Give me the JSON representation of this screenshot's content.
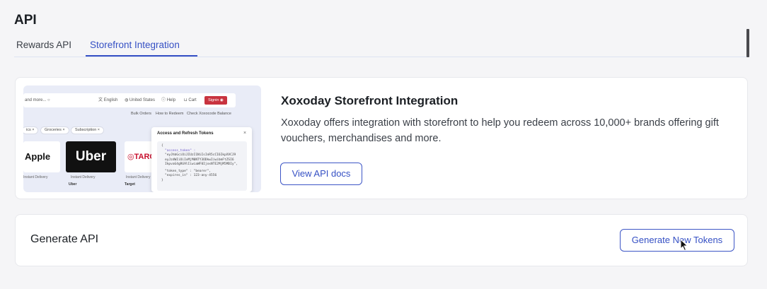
{
  "page": {
    "title": "API"
  },
  "tabs": [
    {
      "label": "Rewards API",
      "active": false
    },
    {
      "label": "Storefront Integration",
      "active": true
    }
  ],
  "integration": {
    "title": "Xoxoday Storefront Integration",
    "description": "Xoxoday offers integration with storefront to help you redeem across 10,000+ brands offering gift vouchers, merchandises and more.",
    "docs_button": "View API docs",
    "preview": {
      "search_text": "and more...",
      "nav": [
        "English",
        "United States",
        "Help",
        "Cart"
      ],
      "signin": "Signin",
      "subnav": [
        "Bulk Orders",
        "How to Redeem",
        "Check Xoxocode Balance"
      ],
      "chips": [
        "ics",
        "Groceries",
        "Subscription"
      ],
      "brands": [
        "Apple",
        "Uber",
        "TARG"
      ],
      "brand_captions": [
        "Instant Delivery",
        "Instant Delivery",
        "Instant Delivery"
      ],
      "brand_names": [
        "Uber",
        "Target"
      ],
      "popup_title": "Access and Refresh Tokens",
      "popup_close": "×",
      "code": {
        "open": "{",
        "access_key": "\"access_token\" :",
        "access_lines": [
          "\"eyJhbGciOiJIUzI1NiIsInR5cCI6IkpXVCJ9",
          "eyJzdWIiOiIxMjM0NTY3ODkwIiwibmFtZSI6",
          "IkpvaG4gRG9lIiwiaWF0IjoxNTE2MjM5MDIy\","
        ],
        "token_type": "\"token_type\" : \"bearer\",",
        "expires": "\"expires_in\" : 123-any-4556",
        "close": "}"
      }
    }
  },
  "generate": {
    "title": "Generate API",
    "button": "Generate New Tokens"
  },
  "colors": {
    "accent": "#3550c4",
    "background": "#f5f5f7",
    "card": "#ffffff",
    "signin": "#c8333f"
  }
}
